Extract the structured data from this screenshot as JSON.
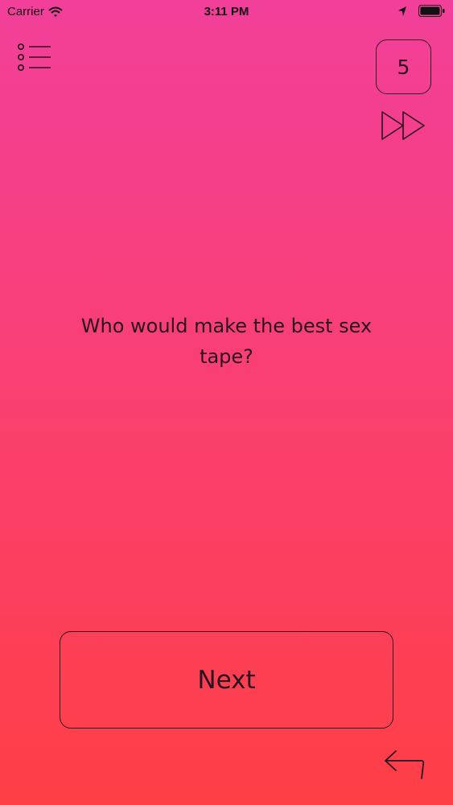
{
  "status_bar": {
    "carrier": "Carrier",
    "time": "3:11 PM",
    "icons": [
      "wifi-icon",
      "location-icon",
      "battery-icon"
    ]
  },
  "header": {
    "menu_icon": "list-menu-icon",
    "counter": "5",
    "skip_icon": "fast-forward-icon"
  },
  "main": {
    "question": "Who would make the best sex tape?"
  },
  "footer": {
    "next_label": "Next",
    "back_icon": "undo-arrow-icon"
  },
  "colors": {
    "gradient_top": "#f23f9a",
    "gradient_bottom": "#fe3f45",
    "ink": "#2a1420"
  }
}
